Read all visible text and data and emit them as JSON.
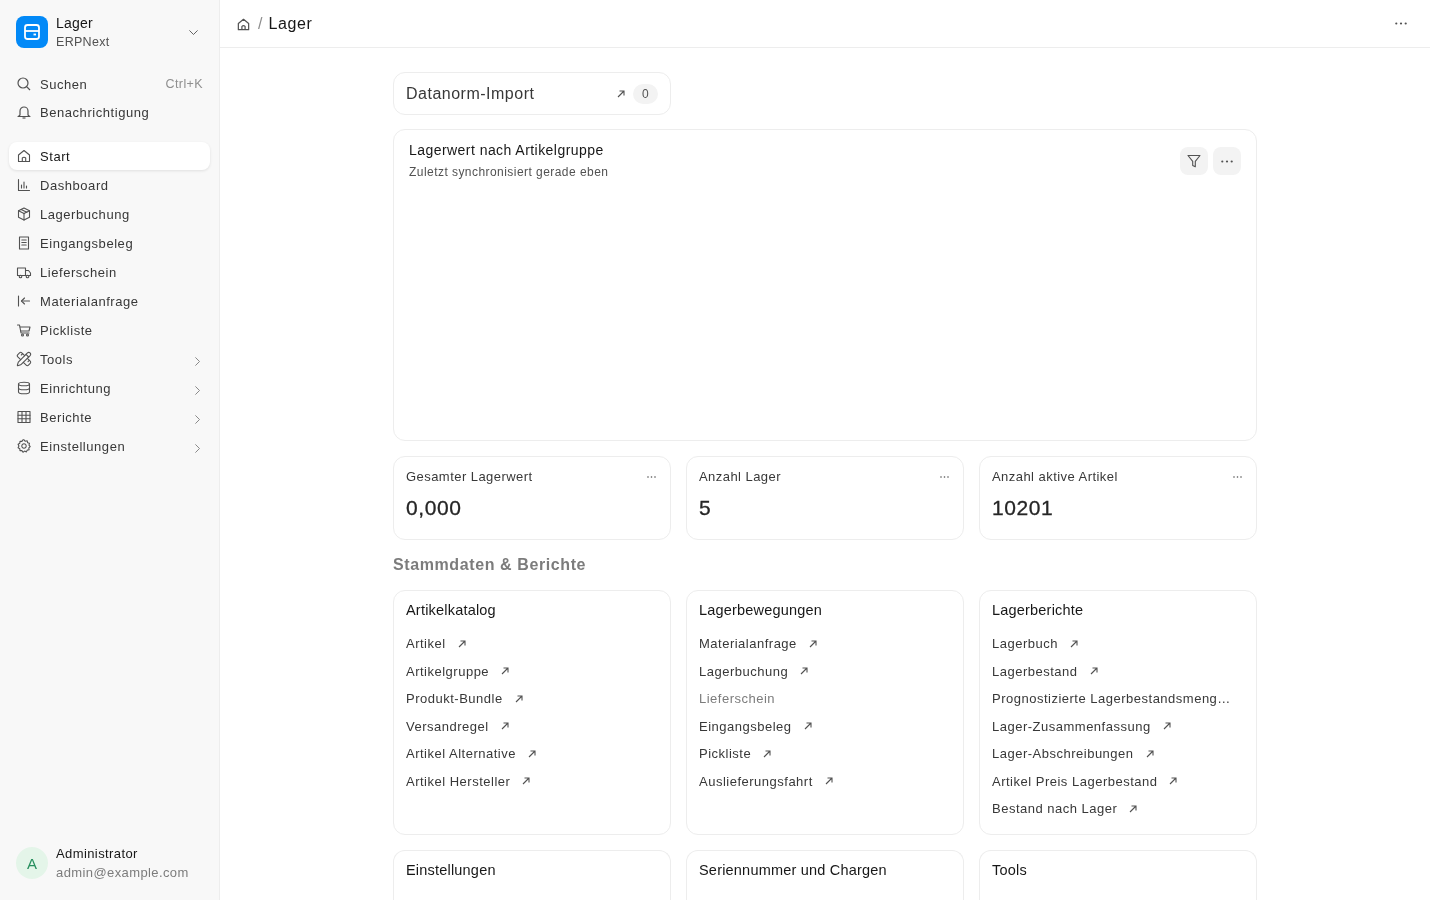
{
  "sidebar": {
    "app": {
      "title": "Lager",
      "subtitle": "ERPNext"
    },
    "search": {
      "label": "Suchen",
      "shortcut": "Ctrl+K"
    },
    "notifications": {
      "label": "Benachrichtigung"
    },
    "items": [
      {
        "label": "Start",
        "selected": true,
        "expandable": false
      },
      {
        "label": "Dashboard",
        "selected": false,
        "expandable": false
      },
      {
        "label": "Lagerbuchung",
        "selected": false,
        "expandable": false
      },
      {
        "label": "Eingangsbeleg",
        "selected": false,
        "expandable": false
      },
      {
        "label": "Lieferschein",
        "selected": false,
        "expandable": false
      },
      {
        "label": "Materialanfrage",
        "selected": false,
        "expandable": false
      },
      {
        "label": "Pickliste",
        "selected": false,
        "expandable": false
      },
      {
        "label": "Tools",
        "selected": false,
        "expandable": true
      },
      {
        "label": "Einrichtung",
        "selected": false,
        "expandable": true
      },
      {
        "label": "Berichte",
        "selected": false,
        "expandable": true
      },
      {
        "label": "Einstellungen",
        "selected": false,
        "expandable": true
      }
    ],
    "user": {
      "initial": "A",
      "name": "Administrator",
      "email": "admin@example.com"
    }
  },
  "breadcrumb": {
    "separator": "/",
    "current": "Lager"
  },
  "shortcut": {
    "label": "Datanorm-Import",
    "count": "0"
  },
  "chart_card": {
    "title": "Lagerwert nach Artikelgruppe",
    "subtitle": "Zuletzt synchronisiert gerade eben"
  },
  "number_cards": [
    {
      "label": "Gesamter Lagerwert",
      "value": "0,000"
    },
    {
      "label": "Anzahl Lager",
      "value": "5"
    },
    {
      "label": "Anzahl aktive Artikel",
      "value": "10201"
    }
  ],
  "section_title": "Stammdaten & Berichte",
  "link_cards": [
    {
      "title": "Artikelkatalog",
      "links": [
        {
          "label": "Artikel",
          "disabled": false,
          "arrow": true
        },
        {
          "label": "Artikelgruppe",
          "disabled": false,
          "arrow": true
        },
        {
          "label": "Produkt-Bundle",
          "disabled": false,
          "arrow": true
        },
        {
          "label": "Versandregel",
          "disabled": false,
          "arrow": true
        },
        {
          "label": "Artikel Alternative",
          "disabled": false,
          "arrow": true
        },
        {
          "label": "Artikel Hersteller",
          "disabled": false,
          "arrow": true
        }
      ]
    },
    {
      "title": "Lagerbewegungen",
      "links": [
        {
          "label": "Materialanfrage",
          "disabled": false,
          "arrow": true
        },
        {
          "label": "Lagerbuchung",
          "disabled": false,
          "arrow": true
        },
        {
          "label": "Lieferschein",
          "disabled": true,
          "arrow": false
        },
        {
          "label": "Eingangsbeleg",
          "disabled": false,
          "arrow": true
        },
        {
          "label": "Pickliste",
          "disabled": false,
          "arrow": true
        },
        {
          "label": "Auslieferungsfahrt",
          "disabled": false,
          "arrow": true
        }
      ]
    },
    {
      "title": "Lagerberichte",
      "links": [
        {
          "label": "Lagerbuch",
          "disabled": false,
          "arrow": true
        },
        {
          "label": "Lagerbestand",
          "disabled": false,
          "arrow": true
        },
        {
          "label": "Prognostizierte Lagerbestandsmeng…",
          "disabled": false,
          "arrow": false
        },
        {
          "label": "Lager-Zusammenfassung",
          "disabled": false,
          "arrow": true
        },
        {
          "label": "Lager-Abschreibungen",
          "disabled": false,
          "arrow": true
        },
        {
          "label": "Artikel Preis Lagerbestand",
          "disabled": false,
          "arrow": true
        },
        {
          "label": "Bestand nach Lager",
          "disabled": false,
          "arrow": true
        }
      ]
    },
    {
      "title": "Einstellungen"
    },
    {
      "title": "Seriennummer und Chargen"
    },
    {
      "title": "Tools"
    }
  ]
}
